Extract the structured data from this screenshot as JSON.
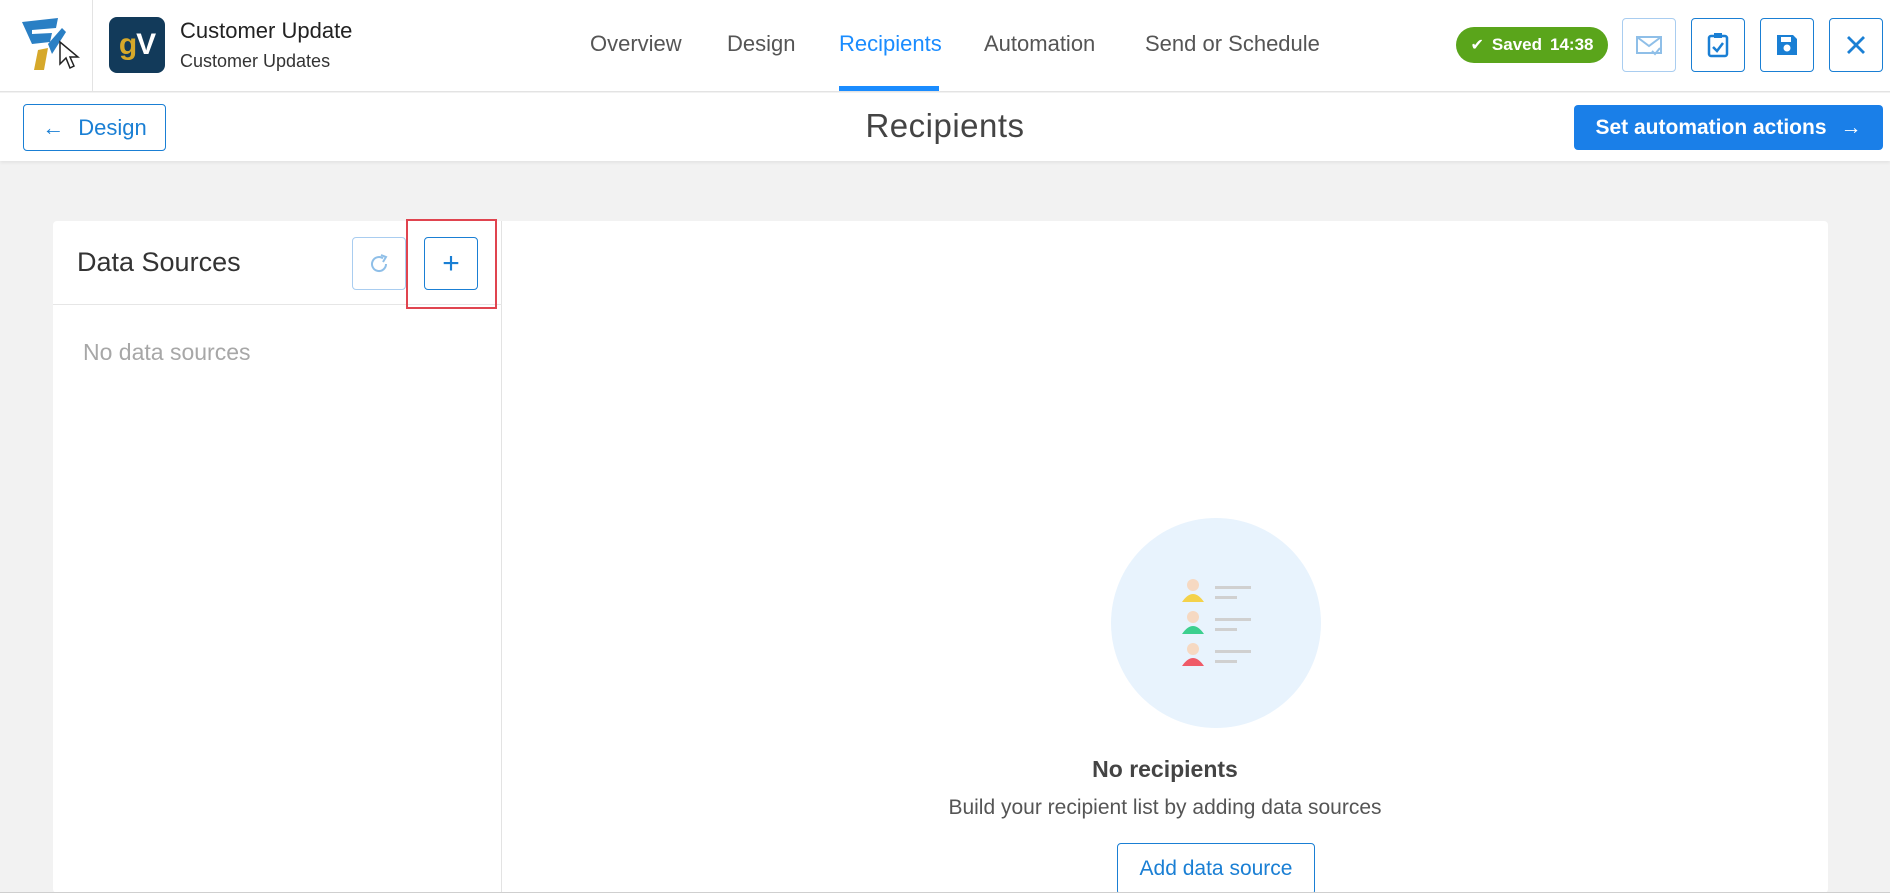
{
  "app": {
    "title": "Customer Update",
    "subtitle": "Customer Updates",
    "icon_text_g": "g",
    "icon_text_v": "V"
  },
  "nav": {
    "items": [
      {
        "label": "Overview",
        "active": false
      },
      {
        "label": "Design",
        "active": false
      },
      {
        "label": "Recipients",
        "active": true
      },
      {
        "label": "Automation",
        "active": false
      },
      {
        "label": "Send or Schedule",
        "active": false
      }
    ]
  },
  "status": {
    "saved_label": "Saved",
    "saved_time": "14:38",
    "color": "#5aa51b"
  },
  "toolbar": {
    "icons": [
      "mail-check-icon",
      "clipboard-check-icon",
      "save-icon",
      "close-icon"
    ]
  },
  "subheader": {
    "back_label": "Design",
    "back_arrow": "←",
    "page_title": "Recipients",
    "next_label": "Set automation actions",
    "next_arrow": "→"
  },
  "data_sources": {
    "title": "Data Sources",
    "add_symbol": "+",
    "empty_text": "No data sources"
  },
  "recipients_empty": {
    "title": "No recipients",
    "subtitle": "Build your recipient list by adding data sources",
    "button_label": "Add data source"
  },
  "colors": {
    "accent": "#1a7fd4",
    "primary": "#1a7fe8",
    "highlight": "#e0444f"
  }
}
